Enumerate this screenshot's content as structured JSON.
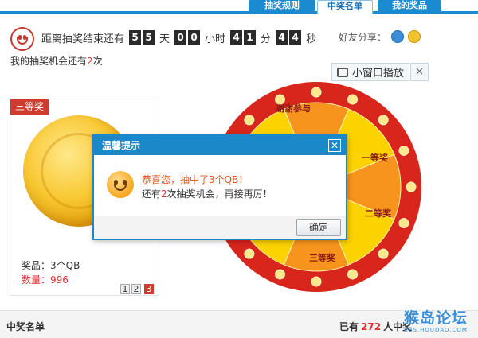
{
  "tabs": [
    {
      "label": "抽奖规则"
    },
    {
      "label": "中奖名单"
    },
    {
      "label": "我的奖品"
    }
  ],
  "countdown": {
    "prefix": "距离抽奖结束还有",
    "days": [
      "5",
      "5"
    ],
    "days_unit": "天",
    "hours": [
      "0",
      "0"
    ],
    "hours_unit": "小时",
    "minutes": [
      "4",
      "1"
    ],
    "minutes_unit": "分",
    "seconds": [
      "4",
      "4"
    ],
    "seconds_unit": "秒"
  },
  "chances": {
    "prefix": "我的抽奖机会还有",
    "count": "2",
    "suffix": "次"
  },
  "share": {
    "label": "好友分享："
  },
  "mini_window": {
    "label": "小窗口播放",
    "close": "×"
  },
  "prize_card": {
    "badge": "三等奖",
    "name": "奖品：3个QB",
    "quantity": "数量：996",
    "pages": [
      "1",
      "2",
      "3"
    ]
  },
  "wheel": {
    "segments": [
      {
        "label": "谢谢参与",
        "color": "#f7941d"
      },
      {
        "label": "一等奖",
        "color": "#fcd200"
      },
      {
        "label": "二等奖",
        "color": "#f7941d"
      },
      {
        "label": "三等奖",
        "color": "#fcd200"
      }
    ]
  },
  "dialog": {
    "title": "温馨提示",
    "close": "✕",
    "message1": "恭喜您，抽中了3个QB！",
    "message2_prefix": "还有",
    "message2_count": "2",
    "message2_suffix": "次抽奖机会，再接再厉！",
    "ok": "确定"
  },
  "winners": {
    "title": "中奖名单",
    "count_prefix": "已有",
    "count": "272",
    "count_suffix": "人中奖"
  },
  "watermark": {
    "main": "猴岛论坛",
    "sub": "BBS.HOUDAO.COM"
  }
}
